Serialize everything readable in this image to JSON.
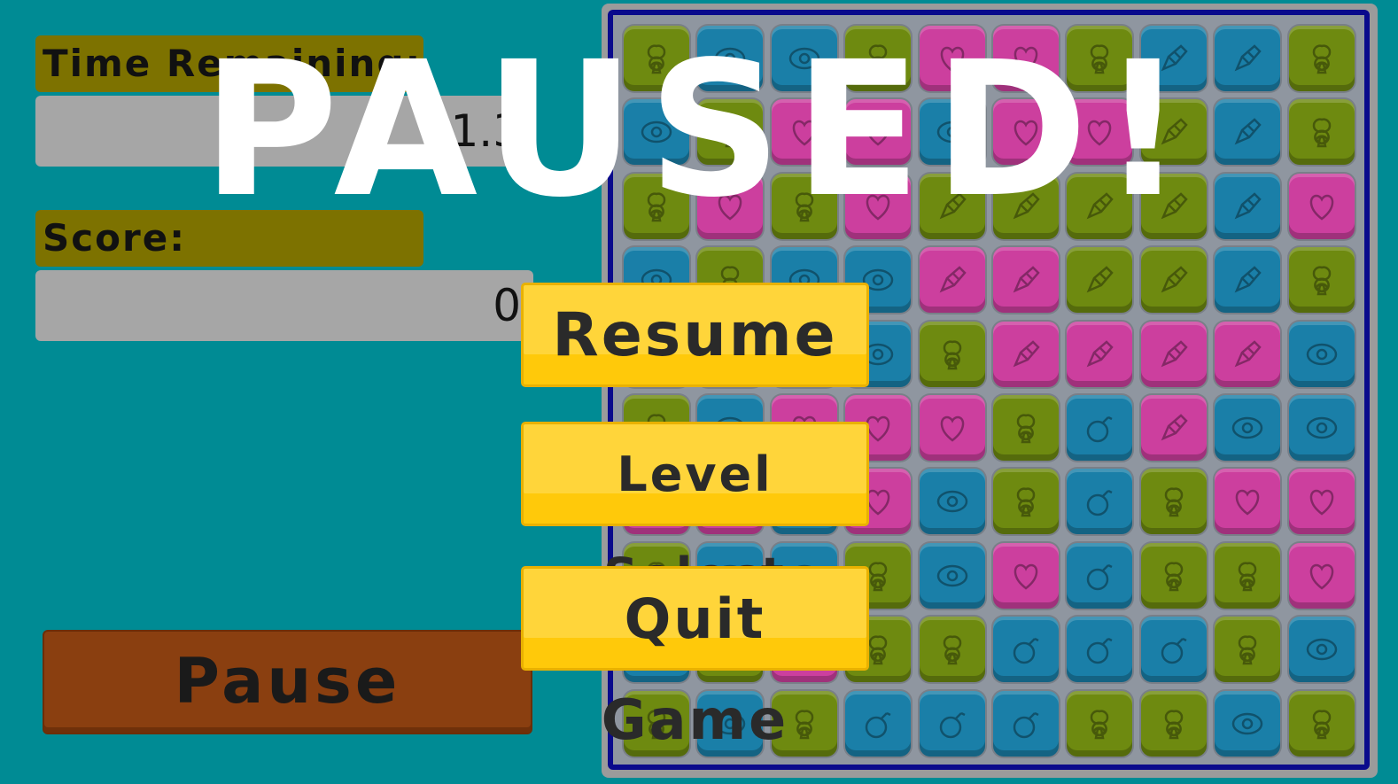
{
  "hud": {
    "time_label": "Time Remaining:",
    "time_value": "21.3",
    "score_label": "Score:",
    "score_value": "0",
    "pause_label": "Pause"
  },
  "overlay": {
    "title": "PAUSED!",
    "resume_label": "Resume",
    "level_select_label": "Level Select",
    "quit_label": "Quit Game"
  },
  "colors": {
    "background": "#008b94",
    "green_tile": "#6e8a10",
    "blue_tile": "#1a7fa8",
    "pink_tile": "#cc3f9e",
    "menu_button": "#ffd53a",
    "pause_button": "#8a3f10",
    "board_border": "#0a0a8c"
  },
  "board": {
    "rows": 10,
    "cols": 10,
    "tiles": [
      [
        "green-club",
        "blue-eye",
        "blue-eye",
        "green-club",
        "pink-heart",
        "pink-heart",
        "green-club",
        "blue-rocket",
        "blue-rocket",
        "green-club"
      ],
      [
        "blue-eye",
        "green-club",
        "pink-heart",
        "pink-heart",
        "blue-eye",
        "pink-heart",
        "pink-heart",
        "green-rocket",
        "blue-rocket",
        "green-club"
      ],
      [
        "green-club",
        "pink-heart",
        "green-club",
        "pink-heart",
        "green-rocket",
        "green-rocket",
        "green-rocket",
        "green-rocket",
        "blue-rocket",
        "pink-heart"
      ],
      [
        "blue-eye",
        "green-club",
        "blue-eye",
        "blue-eye",
        "pink-rocket",
        "pink-rocket",
        "green-rocket",
        "green-rocket",
        "blue-rocket",
        "green-club"
      ],
      [
        "blue-eye",
        "blue-eye",
        "blue-eye",
        "blue-eye",
        "green-club",
        "pink-rocket",
        "pink-rocket",
        "pink-rocket",
        "pink-rocket",
        "blue-eye"
      ],
      [
        "green-club",
        "blue-eye",
        "pink-heart",
        "pink-heart",
        "pink-heart",
        "green-club",
        "blue-bomb",
        "pink-rocket",
        "blue-eye",
        "blue-eye"
      ],
      [
        "pink-heart",
        "pink-heart",
        "blue-eye",
        "pink-heart",
        "blue-eye",
        "green-club",
        "blue-bomb",
        "green-club",
        "pink-heart",
        "pink-heart"
      ],
      [
        "green-club",
        "blue-eye",
        "blue-eye",
        "green-club",
        "blue-eye",
        "pink-heart",
        "blue-bomb",
        "green-club",
        "green-club",
        "pink-heart"
      ],
      [
        "blue-eye",
        "green-club",
        "pink-heart",
        "green-club",
        "green-club",
        "blue-bomb",
        "blue-bomb",
        "blue-bomb",
        "green-club",
        "blue-eye"
      ],
      [
        "green-club",
        "blue-eye",
        "green-club",
        "blue-bomb",
        "blue-bomb",
        "blue-bomb",
        "green-club",
        "green-club",
        "blue-eye",
        "green-club"
      ]
    ]
  }
}
